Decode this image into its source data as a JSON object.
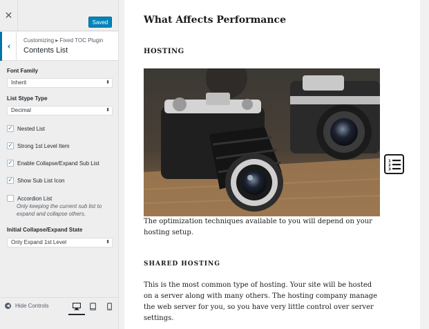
{
  "sidebar": {
    "close_glyph": "✕",
    "save_label": "Saved",
    "back_glyph": "‹",
    "breadcrumb": "Customizing ▸ Fixed TOC Plugin",
    "section_title": "Contents List",
    "font_family": {
      "label": "Font Family",
      "value": "Inherit"
    },
    "list_type": {
      "label": "List Stype Type",
      "value": "Decimal"
    },
    "checkboxes": [
      {
        "label": "Nested List",
        "checked": true
      },
      {
        "label": "Strong 1st Level Item",
        "checked": true
      },
      {
        "label": "Enable Collapse/Expand Sub List",
        "checked": true
      },
      {
        "label": "Show Sub List Icon",
        "checked": true
      },
      {
        "label": "Accordion List",
        "checked": false
      }
    ],
    "accordion_desc_1": "Only keeping the current sub list to",
    "accordion_desc_2": "expand and collapse others.",
    "initial_state": {
      "label": "Initial Collapse/Expand State",
      "value": "Only Expand 1st Level"
    },
    "select_arrow": "⬍",
    "check_mark": "✓",
    "footer": {
      "hide_controls_label": "Hide Controls",
      "hide_glyph": "◀"
    }
  },
  "preview": {
    "heading": "What Affects Performance",
    "subheading": "HOSTING",
    "paragraph_1": "The optimization techniques available to you will depend on your hosting setup.",
    "subheading_2": "SHARED HOSTING",
    "paragraph_2": "This is the most common type of hosting. Your site will be hosted on a server along with many others. The hosting company manage the web server for you, so you have very little control over server settings.",
    "photo_icon": "vintage-cameras-photo",
    "toc_icon": "numbered-list-icon"
  },
  "colors": {
    "accent": "#0085ba",
    "back_accent": "#0073aa",
    "checkbox": "#1e8cbe"
  }
}
